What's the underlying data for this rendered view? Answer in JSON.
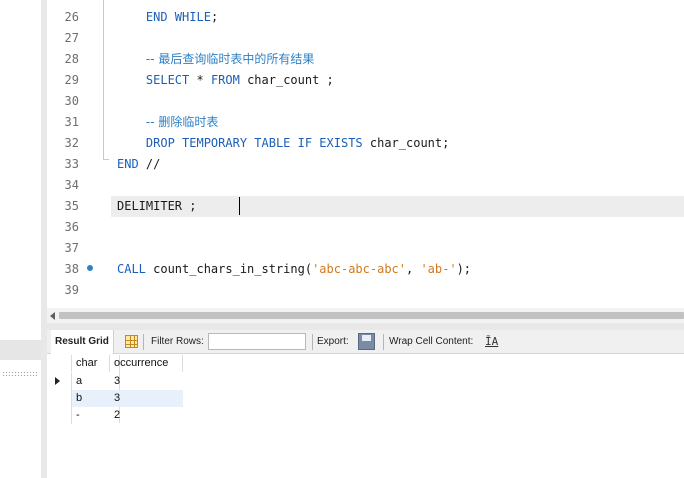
{
  "editor": {
    "lines": [
      {
        "num": "26",
        "segments": [
          {
            "t": "    "
          },
          {
            "t": "END WHILE",
            "c": "kw"
          },
          {
            "t": ";"
          }
        ]
      },
      {
        "num": "27",
        "segments": []
      },
      {
        "num": "28",
        "segments": [
          {
            "t": "    "
          },
          {
            "t": "-- 最后查询临时表中的所有结果",
            "c": "cm"
          }
        ]
      },
      {
        "num": "29",
        "segments": [
          {
            "t": "    "
          },
          {
            "t": "SELECT",
            "c": "kw"
          },
          {
            "t": " * "
          },
          {
            "t": "FROM",
            "c": "kw"
          },
          {
            "t": " char_count ;"
          }
        ]
      },
      {
        "num": "30",
        "segments": []
      },
      {
        "num": "31",
        "segments": [
          {
            "t": "    "
          },
          {
            "t": "-- 删除临时表",
            "c": "cm"
          }
        ]
      },
      {
        "num": "32",
        "segments": [
          {
            "t": "    "
          },
          {
            "t": "DROP TEMPORARY TABLE IF EXISTS",
            "c": "kw"
          },
          {
            "t": " char_count;"
          }
        ]
      },
      {
        "num": "33",
        "segments": [
          {
            "t": "END",
            "c": "kw"
          },
          {
            "t": " //"
          }
        ]
      },
      {
        "num": "34",
        "segments": []
      },
      {
        "num": "35",
        "segments": [
          {
            "t": "DELIMITER ;"
          }
        ]
      },
      {
        "num": "36",
        "segments": []
      },
      {
        "num": "37",
        "segments": []
      },
      {
        "num": "38",
        "segments": [
          {
            "t": "CALL",
            "c": "kw"
          },
          {
            "t": " count_chars_in_string("
          },
          {
            "t": "'abc-abc-abc'",
            "c": "str"
          },
          {
            "t": ", "
          },
          {
            "t": "'ab-'",
            "c": "str"
          },
          {
            "t": ");"
          }
        ]
      },
      {
        "num": "39",
        "segments": []
      }
    ],
    "current_line": "35"
  },
  "toolbar": {
    "result_grid_tab": "Result Grid",
    "filter_rows_label": "Filter Rows:",
    "filter_rows_value": "",
    "export_label": "Export:",
    "wrap_label": "Wrap Cell Content:",
    "wrap_icon_glyph": "ĪA"
  },
  "result_grid": {
    "columns": [
      "char",
      "occurrence"
    ],
    "rows": [
      [
        "a",
        "3"
      ],
      [
        "b",
        "3"
      ],
      [
        "-",
        "2"
      ]
    ],
    "selected_row": 1
  },
  "colors": {
    "keyword": "#1c5fb8",
    "comment": "#2f80c5",
    "string": "#d07a1c",
    "current_line_bg": "#ededed",
    "selected_row_bg": "#e8f1fb"
  },
  "icons": [
    "grid-icon",
    "export-icon",
    "wrap-cell-icon",
    "breakpoint-dot-icon",
    "row-pointer-icon",
    "scroll-left-arrow-icon"
  ]
}
